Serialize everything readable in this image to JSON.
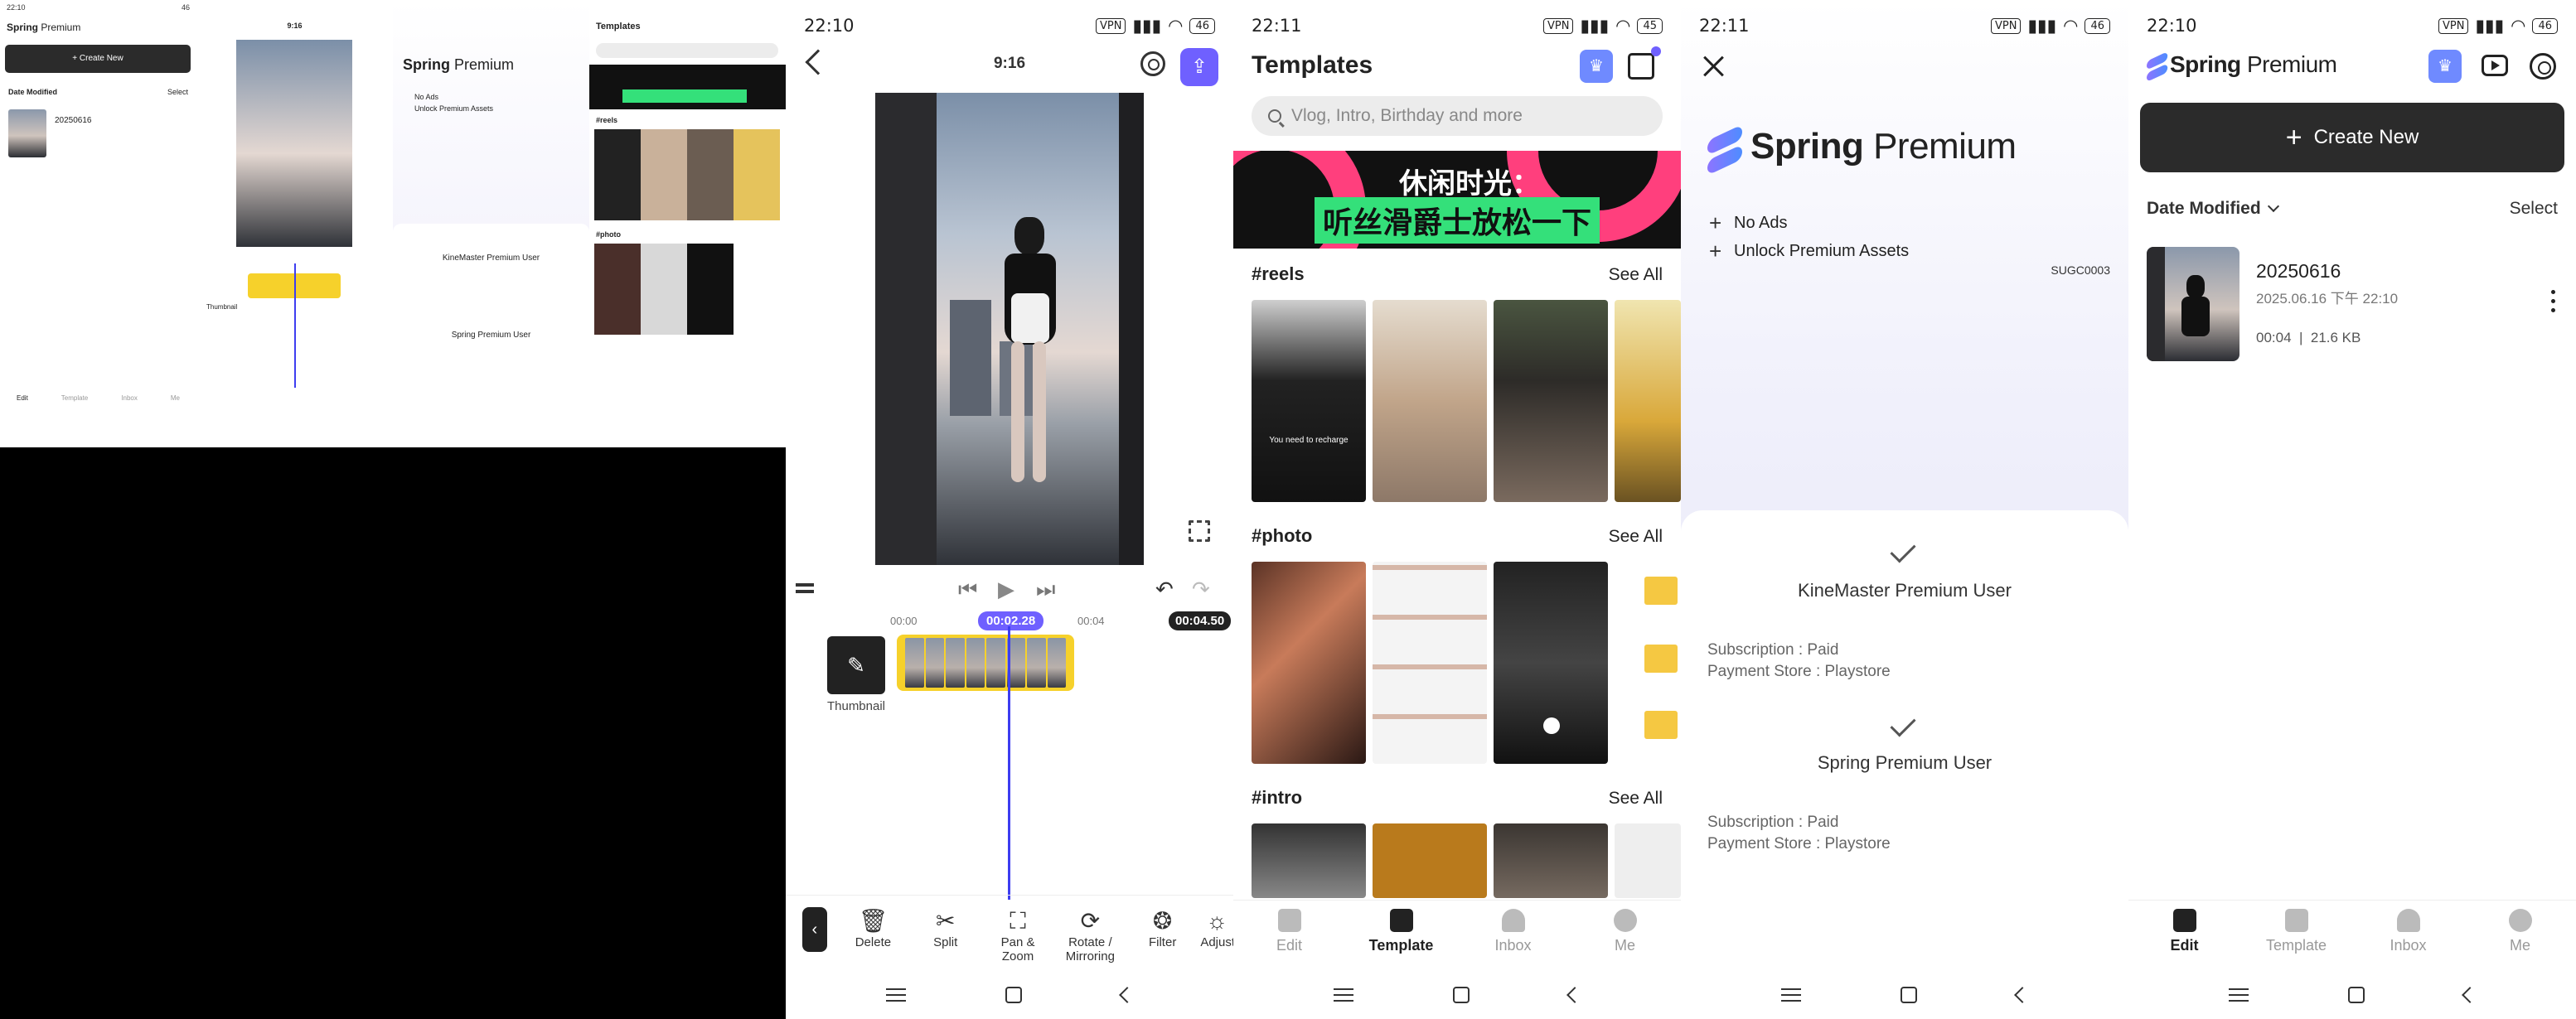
{
  "status": {
    "time_2210": "22:10",
    "time_2211": "22:11",
    "vpn": "VPN",
    "battery": "46",
    "battery_alt": "45"
  },
  "editor": {
    "aspect_ratio": "9:16",
    "export_icon": "share-icon",
    "time_start": "00:00",
    "time_current": "00:02.28",
    "time_mark": "00:04",
    "time_total": "00:04.50",
    "thumbnail_label": "Thumbnail",
    "tools": [
      {
        "label": "Delete",
        "icon": "🗑"
      },
      {
        "label": "Split",
        "icon": "✂"
      },
      {
        "label": "Pan &\nZoom",
        "icon": "⛶"
      },
      {
        "label": "Rotate /\nMirroring",
        "icon": "⟳"
      },
      {
        "label": "Filter",
        "icon": "❂"
      },
      {
        "label": "Adjust",
        "icon": "☼"
      }
    ]
  },
  "templates": {
    "title": "Templates",
    "search_placeholder": "Vlog, Intro, Birthday and more",
    "banner_line1": "休闲时光：",
    "banner_line2": "听丝滑爵士放松一下",
    "sections": [
      {
        "name": "#reels",
        "see_all": "See All"
      },
      {
        "name": "#photo",
        "see_all": "See All"
      },
      {
        "name": "#intro",
        "see_all": "See All"
      }
    ],
    "reel_caption": "You need to recharge",
    "tabs": [
      "Edit",
      "Template",
      "Inbox",
      "Me"
    ]
  },
  "premium": {
    "brand_bold": "Spring",
    "brand_light": "Premium",
    "benefits": [
      "No Ads",
      "Unlock Premium Assets"
    ],
    "code": "SUGC0003",
    "plans": [
      {
        "title": "KineMaster Premium User",
        "line1": "Subscription : Paid",
        "line2": "Payment Store : Playstore"
      },
      {
        "title": "Spring Premium User",
        "line1": "Subscription : Paid",
        "line2": "Payment Store : Playstore"
      }
    ]
  },
  "home": {
    "create_label": "Create New",
    "sort_label": "Date Modified",
    "select_label": "Select",
    "project": {
      "name": "20250616",
      "date": "2025.06.16  下午 22:10",
      "duration": "00:04",
      "size": "21.6 KB"
    },
    "tabs": [
      "Edit",
      "Template",
      "Inbox",
      "Me"
    ]
  },
  "colors": {
    "accent": "#6f60ff",
    "clip": "#f6d12b",
    "banner_pink": "#ff3f7d",
    "banner_green": "#34e07a"
  }
}
